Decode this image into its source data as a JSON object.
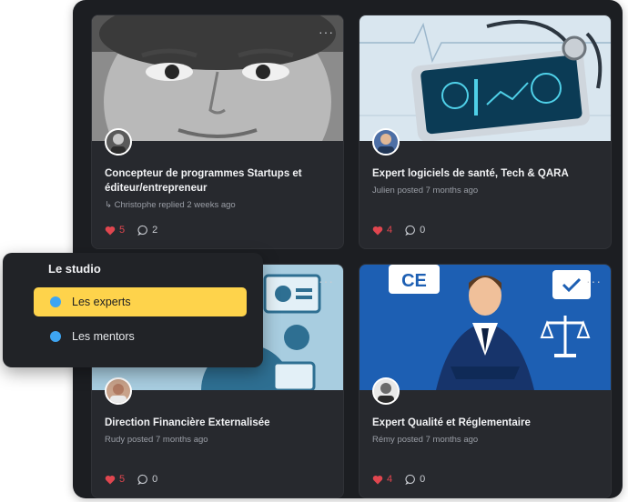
{
  "cards": [
    {
      "title": "Concepteur de programmes Startups et éditeur/entrepreneur",
      "meta": "Christophe replied 2 weeks ago",
      "likes": "5",
      "comments": "2"
    },
    {
      "title": "Expert logiciels de santé, Tech & QARA",
      "meta": "Julien posted 7 months ago",
      "likes": "4",
      "comments": "0"
    },
    {
      "title": "Direction Financière Externalisée",
      "meta": "Rudy posted 7 months ago",
      "likes": "5",
      "comments": "0"
    },
    {
      "title": "Expert Qualité et Réglementaire",
      "meta": "Rémy posted 7 months ago",
      "likes": "4",
      "comments": "0"
    }
  ],
  "menu_dots": "···",
  "reply_arrow": "↳",
  "studio": {
    "heading": "Le studio",
    "items": [
      {
        "label": "Les experts",
        "active": true
      },
      {
        "label": "Les mentors",
        "active": false
      }
    ]
  },
  "colors": {
    "panel": "#1c1e22",
    "card": "#27292e",
    "accent_yellow": "#fed34b",
    "dot_blue": "#3ea5f2",
    "like_red": "#e0464f"
  },
  "icons": {
    "like": "heart-icon",
    "comment": "comment-bubble-icon",
    "menu": "more-dots-icon"
  }
}
